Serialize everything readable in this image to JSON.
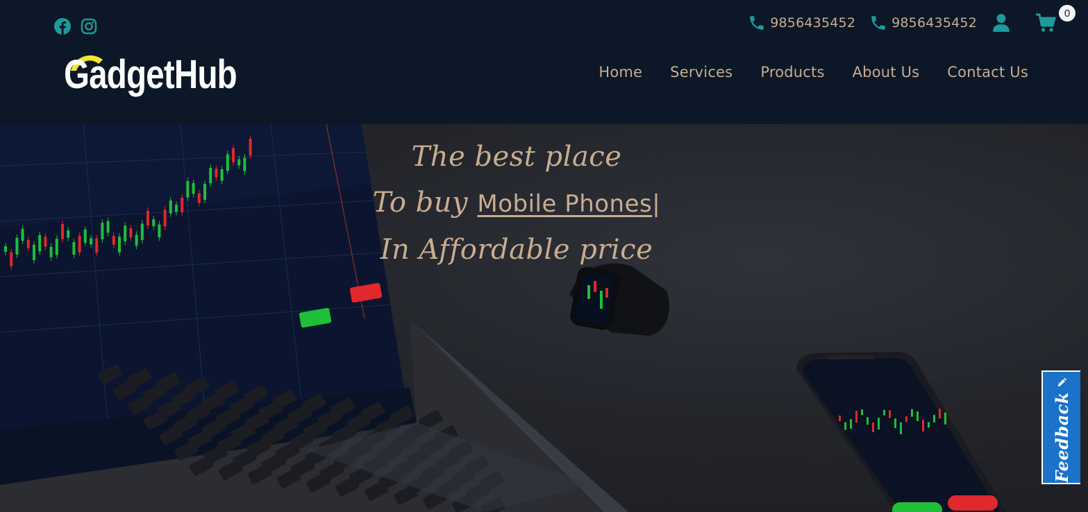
{
  "header": {
    "social": [
      {
        "name": "facebook-icon"
      },
      {
        "name": "instagram-icon"
      }
    ],
    "phones": [
      "9856435452",
      "9856435452"
    ],
    "cart_count": "0",
    "logo": {
      "text": "GadgetHub",
      "arc_color": "#f2e43a"
    },
    "nav": [
      "Home",
      "Services",
      "Products",
      "About Us",
      "Contact Us"
    ]
  },
  "hero": {
    "line1": "The best place",
    "line2_prefix": "To buy",
    "line2_typed": "Mobile Phones",
    "line2_cursor": "|",
    "line3": "In Affordable price"
  },
  "feedback": {
    "label": "Feedback"
  },
  "colors": {
    "header_bg": "#0c1827",
    "accent_teal": "#1f9a9c",
    "text_beige": "#c8ad90",
    "feedback_blue": "#1a73c9"
  }
}
